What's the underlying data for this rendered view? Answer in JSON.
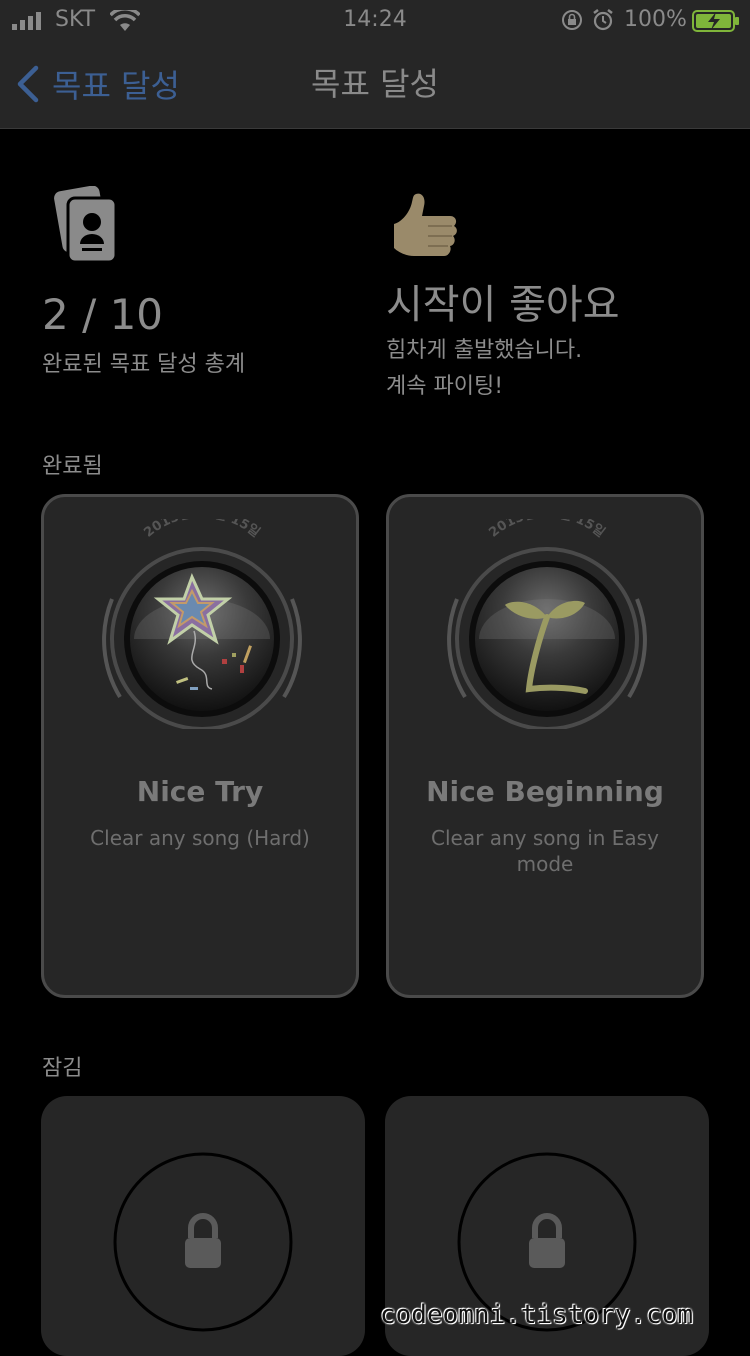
{
  "status_bar": {
    "carrier": "SKT",
    "time": "14:24",
    "battery": "100%"
  },
  "nav": {
    "back_label": "목표 달성",
    "title": "목표 달성"
  },
  "summary": {
    "count": "2 / 10",
    "count_caption": "완료된 목표 달성 총계",
    "encourage_title": "시작이 좋아요",
    "encourage_line1": "힘차게 출발했습니다.",
    "encourage_line2": "계속 파이팅!"
  },
  "completed": {
    "label": "완료됨",
    "cards": [
      {
        "title": "Nice Try",
        "description": "Clear any song (Hard)",
        "date": "2013년 12월 15일",
        "badge_icon": "star-balloon-icon"
      },
      {
        "title": "Nice Beginning",
        "description": "Clear any song in Easy mode",
        "date": "2013년 12월 15일",
        "badge_icon": "sprout-icon"
      }
    ]
  },
  "locked": {
    "label": "잠김",
    "cards": [
      {
        "icon": "lock-icon"
      },
      {
        "icon": "lock-icon"
      }
    ]
  },
  "watermark": "codeomni.tistory.com",
  "colors": {
    "background": "#000000",
    "card": "#262626",
    "back_accent": "#3c5f93",
    "text_muted": "#8c8c8c",
    "battery_green": "#7fb53a"
  }
}
